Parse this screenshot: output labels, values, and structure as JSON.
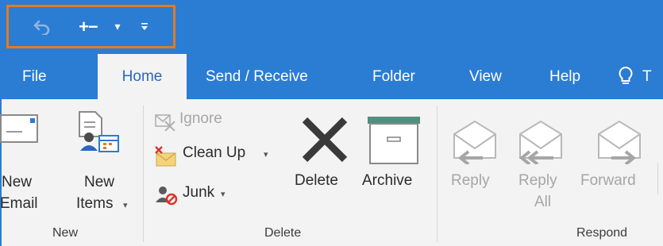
{
  "qat": {
    "undo": "undo-icon",
    "send_receive": "+−",
    "dropdown": "▾",
    "customize": "customize-qat-icon"
  },
  "tabs": [
    {
      "label": "File"
    },
    {
      "label": "Home"
    },
    {
      "label": "Send / Receive"
    },
    {
      "label": "Folder"
    },
    {
      "label": "View"
    },
    {
      "label": "Help"
    },
    {
      "label": "T"
    }
  ],
  "ribbon": {
    "new_group": {
      "new_email": {
        "line1": "New",
        "line2": "Email"
      },
      "new_items": {
        "line1": "New",
        "line2": "Items",
        "caret": "▾"
      },
      "label": "New"
    },
    "delete_group": {
      "ignore": "Ignore",
      "clean_up": "Clean Up",
      "clean_up_caret": "▾",
      "junk": "Junk",
      "junk_caret": "▾",
      "delete": "Delete",
      "archive": "Archive",
      "label": "Delete"
    },
    "respond_group": {
      "reply": "Reply",
      "reply_all": {
        "line1": "Reply",
        "line2": "All"
      },
      "forward": "Forward",
      "label": "Respond"
    }
  },
  "colors": {
    "brand_blue": "#2b7cd3",
    "highlight_box": "#e07b24",
    "ribbon_bg": "#f3f3f3",
    "active_tab_text": "#2b66c0"
  }
}
